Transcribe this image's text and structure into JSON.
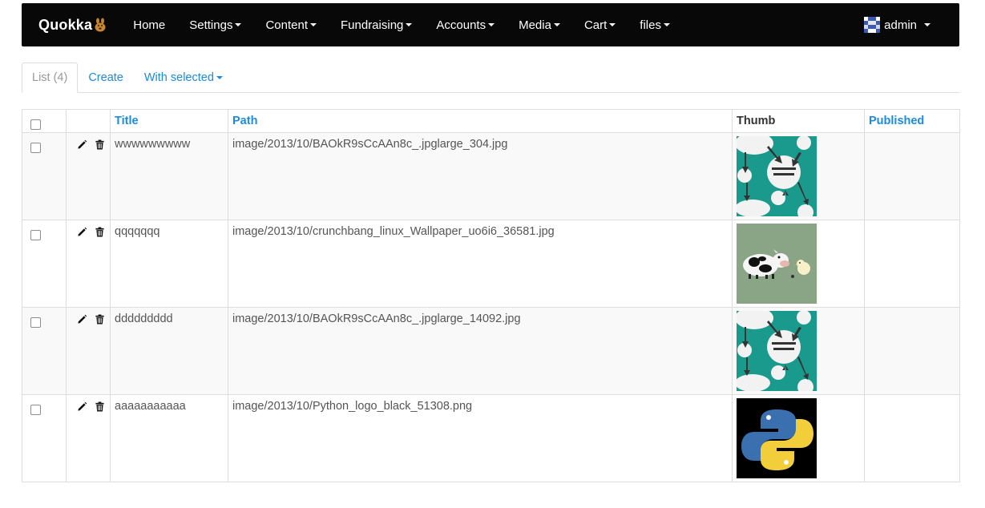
{
  "brand": {
    "name": "Quokka"
  },
  "nav": {
    "items": [
      {
        "label": "Home",
        "dropdown": false
      },
      {
        "label": "Settings",
        "dropdown": true
      },
      {
        "label": "Content",
        "dropdown": true
      },
      {
        "label": "Fundraising",
        "dropdown": true
      },
      {
        "label": "Accounts",
        "dropdown": true
      },
      {
        "label": "Media",
        "dropdown": true
      },
      {
        "label": "Cart",
        "dropdown": true
      },
      {
        "label": "files",
        "dropdown": true
      }
    ],
    "user": "admin"
  },
  "tabs": {
    "list": "List (4)",
    "create": "Create",
    "with_selected": "With selected"
  },
  "table": {
    "columns": {
      "title": "Title",
      "path": "Path",
      "thumb": "Thumb",
      "published": "Published"
    },
    "rows": [
      {
        "title": "wwwwwwwww",
        "path": "image/2013/10/BAOkR9sCcAAn8c_.jpglarge_304.jpg",
        "thumb": "worry-poster",
        "published": ""
      },
      {
        "title": "qqqqqqq",
        "path": "image/2013/10/crunchbang_linux_Wallpaper_uo6i6_36581.jpg",
        "thumb": "cow-chick-wallpaper",
        "published": ""
      },
      {
        "title": "ddddddddd",
        "path": "image/2013/10/BAOkR9sCcAAn8c_.jpglarge_14092.jpg",
        "thumb": "worry-poster",
        "published": ""
      },
      {
        "title": "aaaaaaaaaaa",
        "path": "image/2013/10/Python_logo_black_51308.png",
        "thumb": "python-logo",
        "published": ""
      }
    ]
  },
  "colors": {
    "navbar": "#080808",
    "link": "#1a8be6",
    "stripe": "#f9f9f9",
    "border": "#dddddd"
  }
}
